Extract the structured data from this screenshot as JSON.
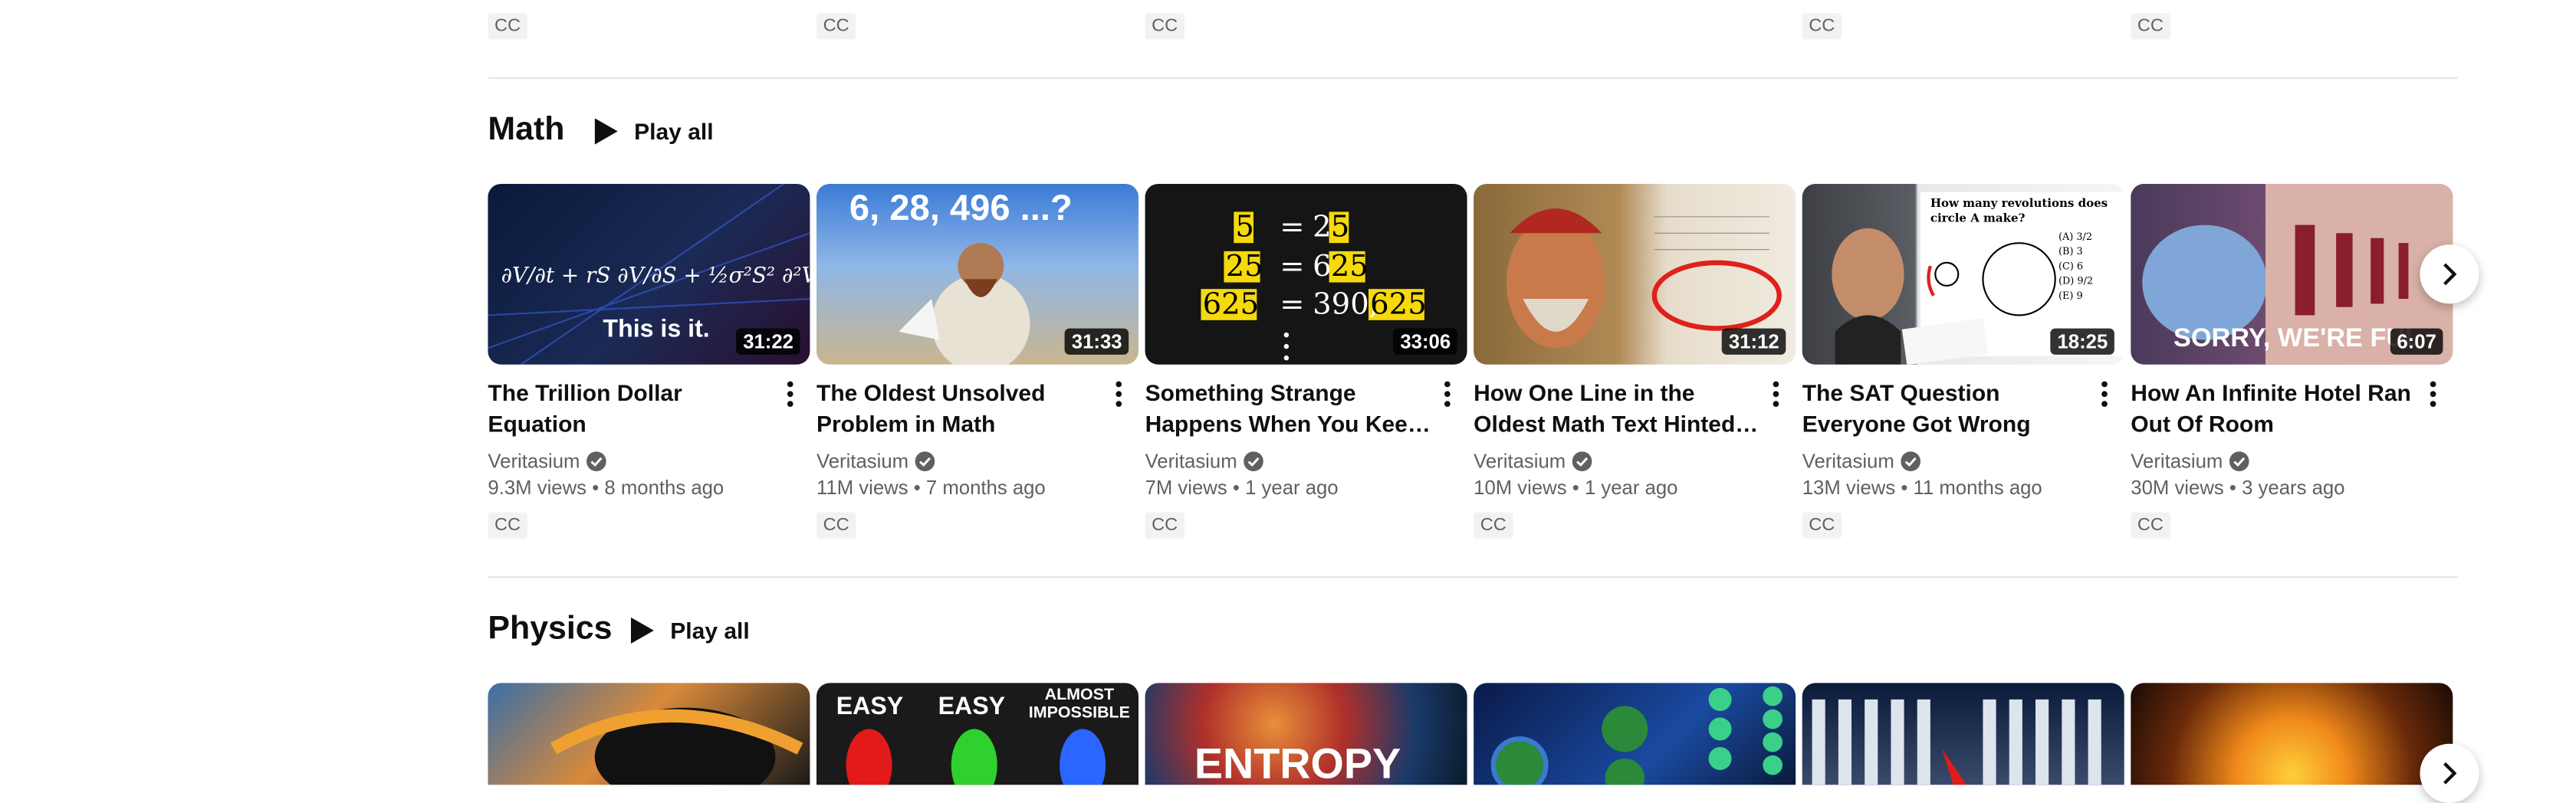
{
  "previous_row": {
    "cc_labels": [
      "CC",
      "CC",
      "CC",
      "CC",
      "CC"
    ]
  },
  "math": {
    "title": "Math",
    "play_all": "Play all",
    "videos": [
      {
        "title": "The Trillion Dollar Equation",
        "channel": "Veritasium",
        "views": "9.3M views",
        "age": "8 months ago",
        "duration": "31:22",
        "cc": "CC",
        "thumb_text": "This is it."
      },
      {
        "title": "The Oldest Unsolved Problem in Math",
        "channel": "Veritasium",
        "views": "11M views",
        "age": "7 months ago",
        "duration": "31:33",
        "cc": "CC",
        "thumb_text": "6, 28, 496 ...?"
      },
      {
        "title": "Something Strange Happens When You Keep Squaring",
        "channel": "Veritasium",
        "views": "7M views",
        "age": "1 year ago",
        "duration": "33:06",
        "cc": "CC",
        "thumb_text": ""
      },
      {
        "title": "How One Line in the Oldest Math Text Hinted at Hidden Universes",
        "channel": "Veritasium",
        "views": "10M views",
        "age": "1 year ago",
        "duration": "31:12",
        "cc": "CC",
        "thumb_text": ""
      },
      {
        "title": "The SAT Question Everyone Got Wrong",
        "channel": "Veritasium",
        "views": "13M views",
        "age": "11 months ago",
        "duration": "18:25",
        "cc": "CC",
        "thumb_text": "How many revolutions does circle A make?"
      },
      {
        "title": "How An Infinite Hotel Ran Out Of Room",
        "channel": "Veritasium",
        "views": "30M views",
        "age": "3 years ago",
        "duration": "6:07",
        "cc": "CC",
        "thumb_text": "SORRY, WE'RE FUL"
      }
    ]
  },
  "physics": {
    "title": "Physics",
    "play_all": "Play all",
    "thumb_texts": [
      "",
      "EASY",
      "EASY",
      "ALMOST IMPOSSIBLE",
      "ENTROPY",
      "",
      "",
      ""
    ]
  },
  "separator": "•",
  "colors": {
    "accent": "#0f0f0f",
    "secondary_text": "#606060",
    "divider": "#e5e5e5"
  }
}
